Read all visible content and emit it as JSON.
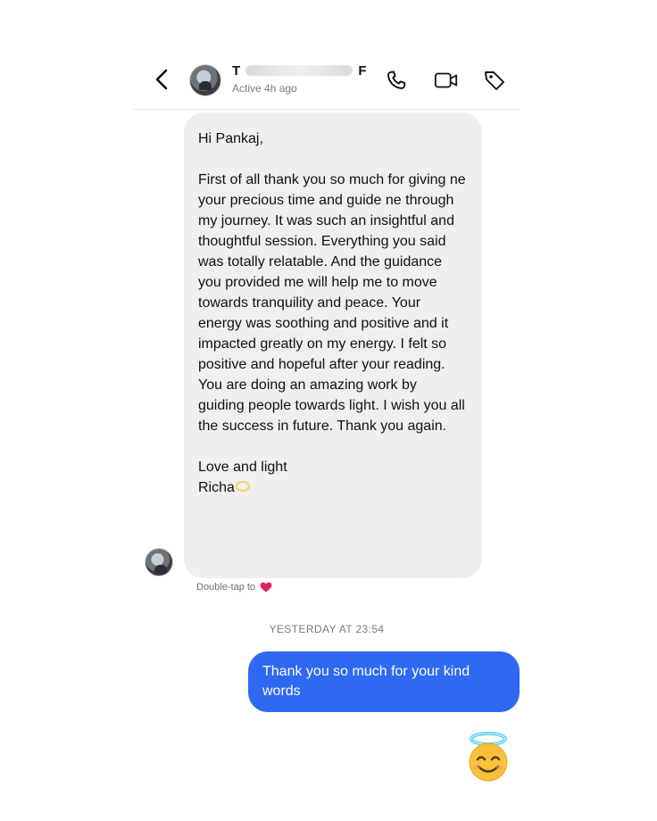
{
  "header": {
    "name_initial": "T",
    "name_second_initial": "F",
    "status": "Active 4h ago",
    "back_glyph": "‹",
    "icons": [
      "back-arrow-icon",
      "phone-icon",
      "video-call-icon",
      "tag-icon"
    ]
  },
  "message_in": {
    "greeting": "Hi Pankaj,",
    "body": "First of all thank you so much for giving ne your precious time and guide ne through my journey. It was such an insightful and thoughtful session. Everything you said was totally relatable. And the guidance you provided me will help me to move towards tranquility and peace. Your energy was soothing and positive and it impacted greatly on my energy. I felt so positive and hopeful after your reading. You are doing an amazing work by guiding people towards light. I wish you all the success in future. Thank you again.",
    "signoff": "Love and light",
    "signature": "Richa"
  },
  "reaction_hint": "Double-tap to",
  "timestamp": "YESTERDAY AT 23:54",
  "message_out": {
    "text": "Thank you so much for your kind words"
  },
  "colors": {
    "outgoing_bubble": "#2e69f2",
    "incoming_bubble": "#efefef",
    "heart": "#e0245e"
  }
}
